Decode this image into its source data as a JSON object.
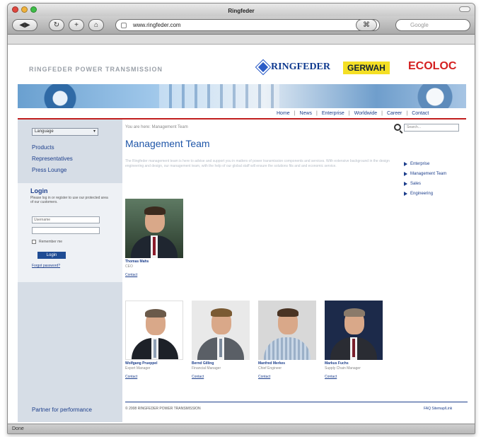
{
  "window": {
    "title": "Ringfeder",
    "url": "www.ringfeder.com",
    "search_placeholder": "Google",
    "status": "Done",
    "light_colors": [
      "#e0473e",
      "#f0b23c",
      "#3ebd47"
    ]
  },
  "site": {
    "brand_text": "RINGFEDER POWER TRANSMISSION",
    "logos": {
      "ringfeder": "RINGFEDER",
      "gerwah": "GERWAH",
      "ecoloc": "ECOLOC"
    },
    "top_nav": [
      "Home",
      "News",
      "Enterprise",
      "Worldwide",
      "Career",
      "Contact"
    ],
    "accent_color": "#c11e1e",
    "link_color": "#1d3f8c"
  },
  "sidebar": {
    "language_label": "Language",
    "nav": [
      "Products",
      "Representatives",
      "Press Lounge"
    ],
    "login": {
      "title": "Login",
      "description": "Please log in or register to use our protected area of our customers.",
      "username_placeholder": "Username",
      "remember_label": "Remember me",
      "button_label": "Login",
      "forgot_label": "Forgot password?"
    },
    "partner_text": "Partner for performance"
  },
  "main": {
    "breadcrumb": "You are here: Management Team",
    "search_placeholder": "Search...",
    "title": "Management Team",
    "intro": "The Ringfeder management team is here to advise and support you in matters of power transmission components and services. With extensive background in the design engineering and design, our management team, with the help of our global staff will ensure the solutions fits and and economic service.",
    "right_nav": [
      "Enterprise",
      "Management Team",
      "Sales",
      "Engineering"
    ],
    "ceo": {
      "name": "Thomas Mahs",
      "role": "CEO",
      "contact": "Contact"
    },
    "team": [
      {
        "name": "Wolfgang Prueppel",
        "role": "Export Manager",
        "contact": "Contact"
      },
      {
        "name": "Bernd Gilling",
        "role": "Financial Manager",
        "contact": "Contact"
      },
      {
        "name": "Manfred Merkes",
        "role": "Chief Engineer",
        "contact": "Contact"
      },
      {
        "name": "Markus Fuchs",
        "role": "Supply Chain Manager",
        "contact": "Contact"
      }
    ],
    "footer_left": "© 2008 RINGFEDER POWER TRANSMISSION",
    "footer_right": "FAQ  Sitemap/Link"
  }
}
